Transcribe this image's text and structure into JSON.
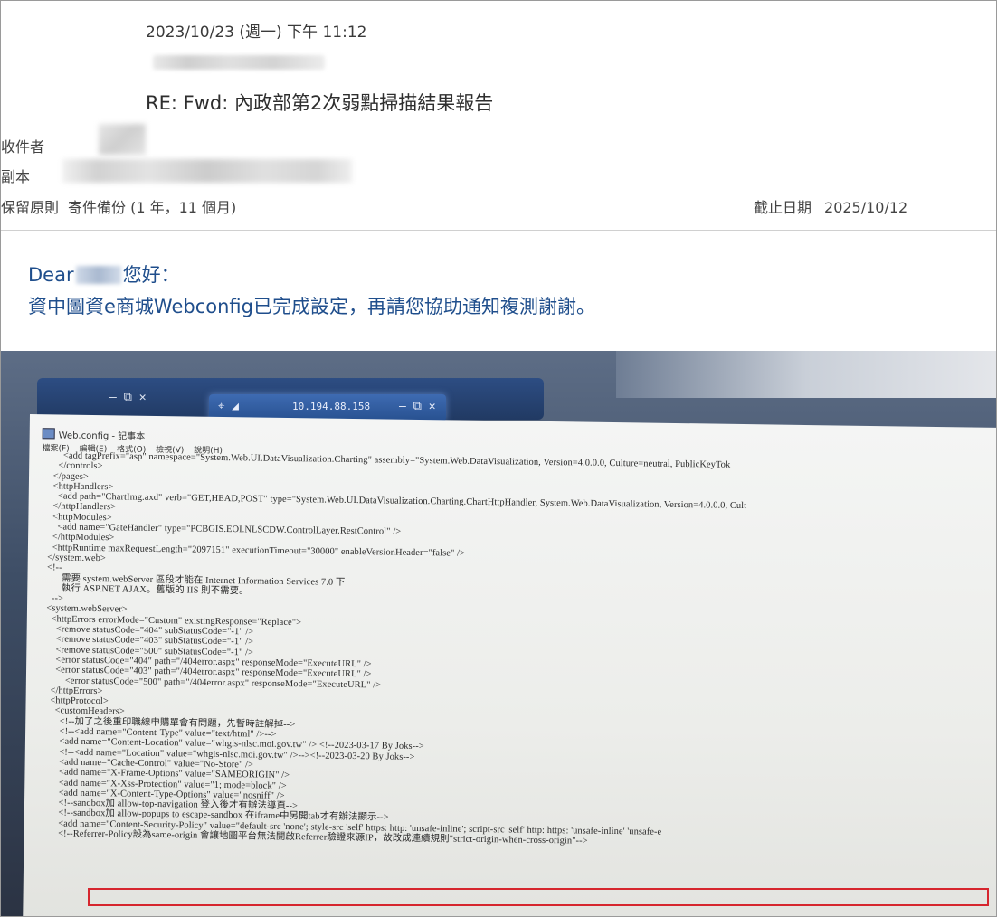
{
  "email": {
    "date": "2023/10/23 (週一) 下午 11:12",
    "subject": "RE: Fwd: 內政部第2次弱點掃描結果報告",
    "to_label": "收件者",
    "cc_label": "副本",
    "retention_label": "保留原則",
    "retention_value": "寄件備份 (1 年，11 個月)",
    "deadline_label": "截止日期",
    "deadline_value": "2025/10/12"
  },
  "message": {
    "greeting_prefix": "Dear",
    "greeting_suffix": "您好：",
    "body_line": "資中圖資e商城Webconfig已完成設定，再請您協助通知複測謝謝。"
  },
  "screenshot_photo": {
    "remote_ip": "10.194.88.158",
    "window_title": "Web.config - 記事本",
    "menu_items": [
      "檔案(F)",
      "編輯(E)",
      "格式(O)",
      "檢視(V)",
      "說明(H)"
    ],
    "code_lines": [
      "        <add tagPrefix=\"asp\" namespace=\"System.Web.UI.DataVisualization.Charting\" assembly=\"System.Web.DataVisualization, Version=4.0.0.0, Culture=neutral, PublicKeyTok",
      "      </controls>",
      "    </pages>",
      "    <httpHandlers>",
      "      <add path=\"ChartImg.axd\" verb=\"GET,HEAD,POST\" type=\"System.Web.UI.DataVisualization.Charting.ChartHttpHandler, System.Web.DataVisualization, Version=4.0.0.0, Cult",
      "    </httpHandlers>",
      "    <httpModules>",
      "      <add name=\"GateHandler\" type=\"PCBGIS.EOI.NLSCDW.ControlLayer.RestControl\" />",
      "    </httpModules>",
      "    <httpRuntime maxRequestLength=\"2097151\" executionTimeout=\"30000\" enableVersionHeader=\"false\" />",
      "  </system.web>",
      "  <!--",
      "        需要 system.webServer 區段才能在 Internet Information Services 7.0 下",
      "        執行 ASP.NET AJAX。舊版的 IIS 則不需要。",
      "    -->",
      "  <system.webServer>",
      "    <httpErrors errorMode=\"Custom\" existingResponse=\"Replace\">",
      "      <remove statusCode=\"404\" subStatusCode=\"-1\" />",
      "      <remove statusCode=\"403\" subStatusCode=\"-1\" />",
      "      <remove statusCode=\"500\" subStatusCode=\"-1\" />",
      "      <error statusCode=\"404\" path=\"/404error.aspx\" responseMode=\"ExecuteURL\" />",
      "      <error statusCode=\"403\" path=\"/404error.aspx\" responseMode=\"ExecuteURL\" />",
      "          <error statusCode=\"500\" path=\"/404error.aspx\" responseMode=\"ExecuteURL\" />",
      "    </httpErrors>",
      "    <httpProtocol>",
      "      <customHeaders>",
      "        <!--加了之後重印職線申購單會有問題，先暫時註解掉-->",
      "        <!--<add name=\"Content-Type\" value=\"text/html\" />-->",
      "        <add name=\"Content-Location\" value=\"whgis-nlsc.moi.gov.tw\" /> <!--2023-03-17 By Joks-->",
      "        <!--<add name=\"Location\" value=\"whgis-nlsc.moi.gov.tw\" />--><!--2023-03-20 By Joks-->",
      "        <add name=\"Cache-Control\" value=\"No-Store\" />",
      "        <add name=\"X-Frame-Options\" value=\"SAMEORIGIN\" />",
      "        <add name=\"X-Xss-Protection\" value=\"1; mode=block\" />",
      "        <add name=\"X-Content-Type-Options\" value=\"nosniff\" />",
      "        <!--sandbox加 allow-top-navigation 登入後才有辦法導頁-->",
      "        <!--sandbox加 allow-popups to escape-sandbox 在iframe中另開tab才有辦法顯示-->",
      "        <add name=\"Content-Security-Policy\" value=\"default-src 'none'; style-src 'self' https: http: 'unsafe-inline'; script-src 'self' http: https: 'unsafe-inline' 'unsafe-e",
      "        <!--Referrer-Policy設為same-origin 會讓地圖平台無法開啟Referrer驗證來源IP，故改成連續規則\"strict-origin-when-cross-origin\"-->"
    ]
  }
}
